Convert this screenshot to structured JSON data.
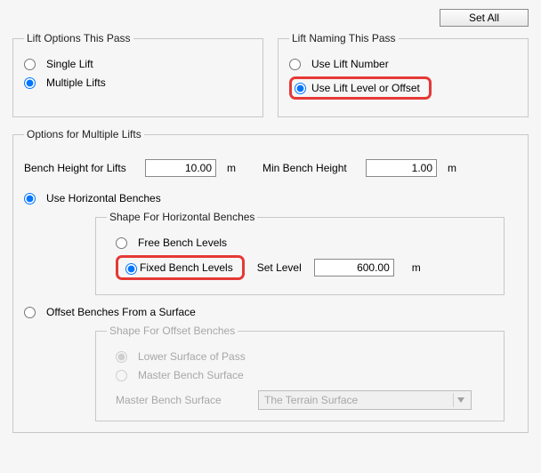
{
  "header": {
    "set_all": "Set All"
  },
  "lift_options": {
    "legend": "Lift Options This Pass",
    "single": "Single Lift",
    "multiple": "Multiple Lifts",
    "selected": "multiple"
  },
  "lift_naming": {
    "legend": "Lift Naming This Pass",
    "use_number": "Use Lift Number",
    "use_level": "Use Lift Level or Offset",
    "selected": "use_level"
  },
  "multiple": {
    "legend": "Options for Multiple Lifts",
    "bench_height_label": "Bench Height for Lifts",
    "bench_height_value": "10.00",
    "bench_height_unit": "m",
    "min_bench_label": "Min Bench Height",
    "min_bench_value": "1.00",
    "min_bench_unit": "m",
    "use_horizontal": "Use Horizontal Benches",
    "offset_surface": "Offset Benches From a Surface",
    "bench_mode": "horizontal",
    "horiz": {
      "legend": "Shape For Horizontal Benches",
      "free": "Free Bench Levels",
      "fixed": "Fixed Bench Levels",
      "selected": "fixed",
      "set_level_label": "Set Level",
      "set_level_value": "600.00",
      "set_level_unit": "m"
    },
    "offset": {
      "legend": "Shape For Offset Benches",
      "lower": "Lower Surface of Pass",
      "master": "Master Bench Surface",
      "master_label": "Master Bench Surface",
      "surface_choice": "The Terrain Surface"
    }
  }
}
